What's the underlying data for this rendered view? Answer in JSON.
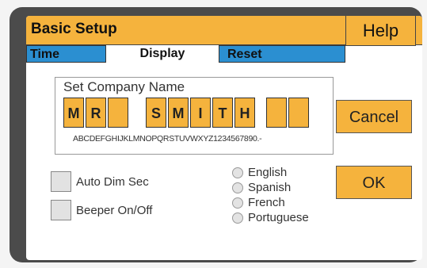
{
  "title": "Basic Setup",
  "help_label": "Help",
  "tabs": [
    {
      "label": "Time"
    },
    {
      "label": "Display"
    },
    {
      "label": "Reset"
    }
  ],
  "company": {
    "label": "Set Company Name",
    "chars": [
      "M",
      "R",
      "",
      "S",
      "M",
      "I",
      "T",
      "H",
      "",
      ""
    ],
    "charset": "ABCDEFGHIJKLMNOPQRSTUVWXYZ1234567890.-"
  },
  "buttons": {
    "cancel": "Cancel",
    "ok": "OK"
  },
  "checkboxes": [
    {
      "label": "Auto Dim Sec"
    },
    {
      "label": "Beeper On/Off"
    }
  ],
  "languages": [
    "English",
    "Spanish",
    "French",
    "Portuguese"
  ],
  "colors": {
    "accent": "#f5b33d",
    "tab_blue": "#2b8fd1",
    "bezel": "#4b4b4b"
  }
}
